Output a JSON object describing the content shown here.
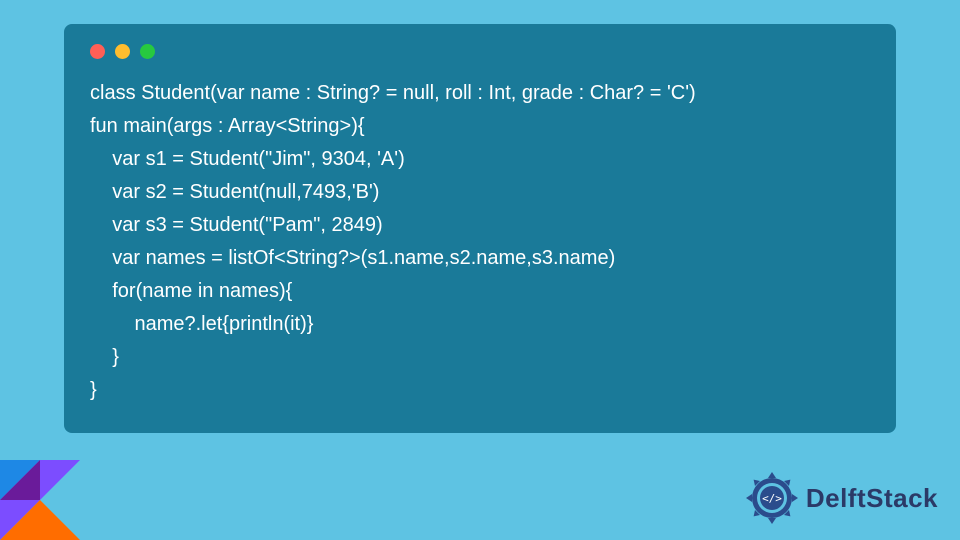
{
  "code": {
    "lines": [
      "class Student(var name : String? = null, roll : Int, grade : Char? = 'C')",
      "fun main(args : Array<String>){",
      "    var s1 = Student(\"Jim\", 9304, 'A')",
      "    var s2 = Student(null,7493,'B')",
      "    var s3 = Student(\"Pam\", 2849)",
      "    var names = listOf<String?>(s1.name,s2.name,s3.name)",
      "    for(name in names){",
      "        name?.let{println(it)}",
      "    }",
      "}"
    ]
  },
  "brand": {
    "name": "DelftStack"
  },
  "colors": {
    "pageBg": "#5EC3E3",
    "windowBg": "#1A7A99",
    "codeText": "#FFFFFF",
    "dotRed": "#FF5F56",
    "dotYellow": "#FFBD2E",
    "dotGreen": "#27C93F",
    "brandText": "#2B3A67"
  }
}
